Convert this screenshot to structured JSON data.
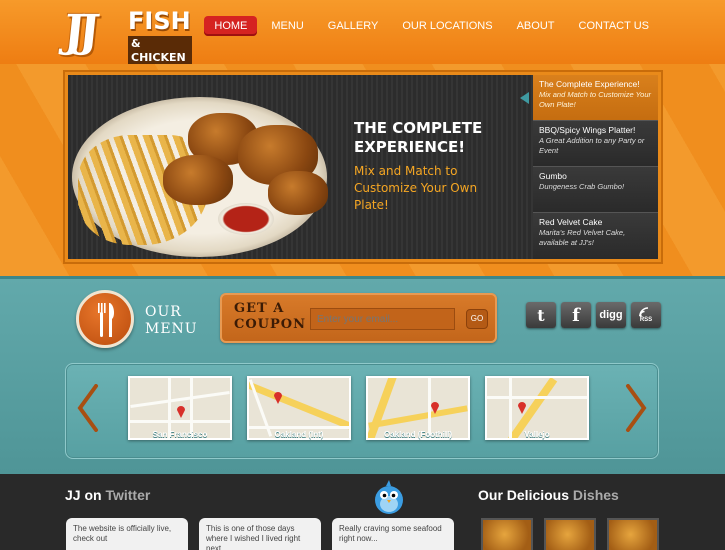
{
  "brand": {
    "logo_jj": "JJ",
    "logo_fish": "FISH",
    "logo_chicken": "& CHICKEN"
  },
  "nav": [
    {
      "label": "HOME",
      "active": true
    },
    {
      "label": "MENU",
      "active": false
    },
    {
      "label": "GALLERY",
      "active": false
    },
    {
      "label": "OUR LOCATIONS",
      "active": false
    },
    {
      "label": "ABOUT",
      "active": false
    },
    {
      "label": "CONTACT US",
      "active": false
    }
  ],
  "slider": {
    "title_line1": "THE COMPLETE",
    "title_line2": "EXPERIENCE!",
    "subtitle": "Mix and Match to Customize Your Own Plate!",
    "items": [
      {
        "title": "The Complete Experience!",
        "subtitle": "Mix and Match to Customize Your Own Plate!"
      },
      {
        "title": "BBQ/Spicy Wings Platter!",
        "subtitle": "A Great Addition to any Party or Event"
      },
      {
        "title": "Gumbo",
        "subtitle": "Dungeness Crab Gumbo!"
      },
      {
        "title": "Red Velvet Cake",
        "subtitle": "Marita's Red Velvet Cake, available at JJ's!"
      }
    ]
  },
  "menu_block": {
    "line1": "OUR",
    "line2": "MENU"
  },
  "coupon": {
    "line1": "GET A",
    "line2": "COUPON",
    "email_placeholder": "Enter your email...",
    "go_label": "GO"
  },
  "social": [
    {
      "name": "twitter",
      "glyph": "t"
    },
    {
      "name": "facebook",
      "glyph": "f"
    },
    {
      "name": "digg",
      "glyph": "digg"
    },
    {
      "name": "rss",
      "glyph": "RSS"
    }
  ],
  "locations": [
    {
      "name": "San Francisco"
    },
    {
      "name": "Oakland (Int)"
    },
    {
      "name": "Oakland (Foothill)"
    },
    {
      "name": "Vallejo"
    }
  ],
  "twitter": {
    "title_prefix": "JJ on",
    "title_brand": "Twitter",
    "tweets": [
      "The website is officially live, check out",
      "This is one of those days where I wished I lived right next",
      "Really craving some seafood right now..."
    ]
  },
  "dishes": {
    "title_prefix": "Our Delicious",
    "title_suffix": "Dishes"
  },
  "colors": {
    "accent_orange": "#ee7d12",
    "nav_active": "#d52321",
    "teal": "#5aa0a2"
  }
}
